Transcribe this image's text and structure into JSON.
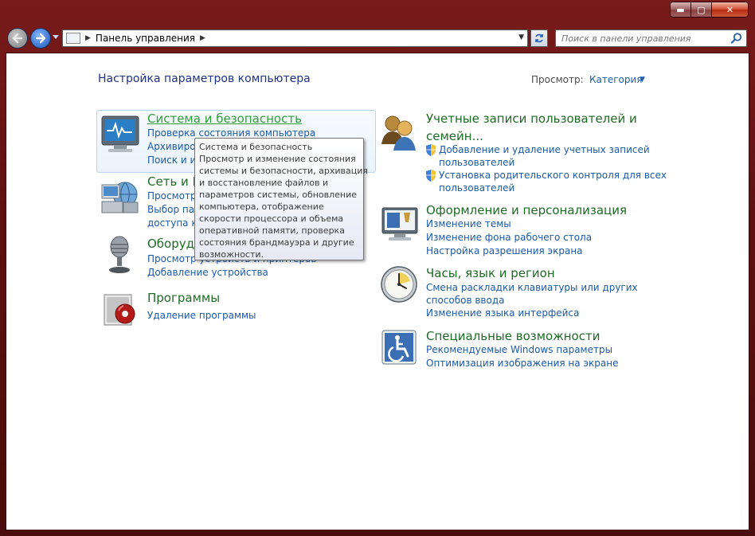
{
  "window": {
    "caption_buttons": {
      "minimize_glyph": "▬",
      "maximize_glyph": "▢",
      "close_glyph": "✕"
    }
  },
  "navigation": {
    "breadcrumb": "Панель управления",
    "search_placeholder": "Поиск в панели управления"
  },
  "header": {
    "page_title": "Настройка параметров компьютера",
    "view_label": "Просмотр:",
    "view_value": "Категория"
  },
  "categories_left": [
    {
      "title": "Система и безопасность",
      "icon": "monitor-pulse-icon",
      "links": [
        "Проверка состояния компьютера",
        "Архивирование данных компьютера",
        "Поиск и исправление проблем"
      ]
    },
    {
      "title": "Сеть и Интернет",
      "icon": "network-icon",
      "links": [
        "Просмотр состояния сети и задач",
        "Выбор параметров домашней группы и",
        "доступа к данным"
      ]
    },
    {
      "title": "Оборудование и звук",
      "icon": "microphone-icon",
      "links": [
        "Просмотр устройств и принтеров",
        "Добавление устройства"
      ]
    },
    {
      "title": "Программы",
      "icon": "programs-disc-icon",
      "links": [
        "Удаление программы"
      ]
    }
  ],
  "categories_right": [
    {
      "title_lines": [
        "Учетные записи пользователей и",
        "семейн..."
      ],
      "icon": "users-icon",
      "links": [
        "Добавление и удаление учетных записей",
        "пользователей",
        "Установка родительского контроля для всех",
        "пользователей"
      ]
    },
    {
      "title": "Оформление и персонализация",
      "icon": "personalization-icon",
      "links": [
        "Изменение темы",
        "Изменение фона рабочего стола",
        "Настройка разрешения экрана"
      ]
    },
    {
      "title": "Часы, язык и регион",
      "icon": "clock-icon",
      "links": [
        "Смена раскладки клавиатуры или других",
        "способов ввода",
        "Изменение языка интерфейса"
      ]
    },
    {
      "title": "Специальные возможности",
      "icon": "accessibility-icon",
      "links": [
        "Рекомендуемые Windows параметры",
        "Оптимизация изображения на экране"
      ]
    }
  ],
  "tooltip": {
    "lines": [
      "Система и безопасность",
      "Просмотр и изменение состояния",
      "системы и безопасности, архивация",
      "и восстановление файлов и",
      "параметров системы, обновление",
      "компьютера, отображение",
      "скорости процессора и объема",
      "оперативной памяти, проверка",
      "состояния брандмауэра и другие",
      "возможности."
    ]
  },
  "colors": {
    "frame": "#5e1010",
    "title_blue": "#1e3287",
    "category_green": "#1d6b24",
    "link_blue": "#1a5aa8"
  }
}
